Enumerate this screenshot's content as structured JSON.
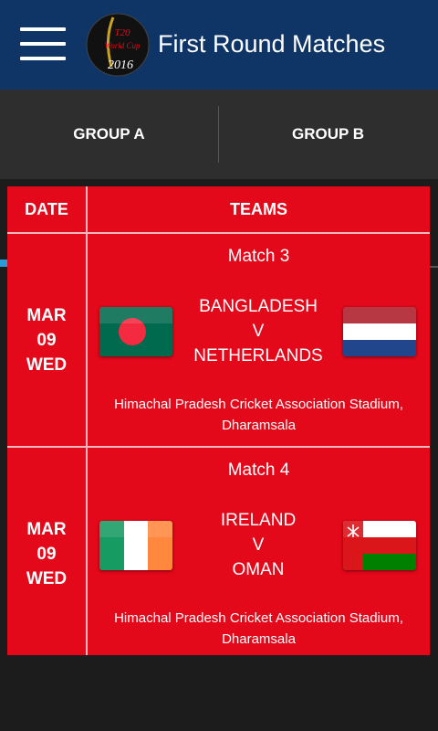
{
  "app_bar": {
    "title": "First Round Matches",
    "logo": {
      "text_top": "T20",
      "text_mid": "World Cup",
      "year": "2016"
    }
  },
  "tabs": [
    {
      "label": "GROUP A",
      "selected": true
    },
    {
      "label": "GROUP B",
      "selected": false
    }
  ],
  "colors": {
    "appbar": "#0f3566",
    "tab_indicator": "#2b9ad9",
    "table_bg": "#e3081a"
  },
  "table": {
    "headers": {
      "date": "DATE",
      "teams": "TEAMS"
    },
    "matches": [
      {
        "match": "Match 3",
        "date": {
          "month": "MAR",
          "day": "09",
          "weekday": "WED"
        },
        "team1": "BANGLADESH",
        "vs": "V",
        "team2": "NETHERLANDS",
        "venue_line1": "Himachal Pradesh Cricket Association Stadium,",
        "venue_line2": "Dharamsala",
        "flag1_icon": "bangladesh-flag-icon",
        "flag2_icon": "netherlands-flag-icon"
      },
      {
        "match": "Match 4",
        "date": {
          "month": "MAR",
          "day": "09",
          "weekday": "WED"
        },
        "team1": "IRELAND",
        "vs": "V",
        "team2": "OMAN",
        "venue_line1": "Himachal Pradesh Cricket Association Stadium,",
        "venue_line2": "Dharamsala",
        "flag1_icon": "ireland-flag-icon",
        "flag2_icon": "oman-flag-icon"
      }
    ]
  }
}
